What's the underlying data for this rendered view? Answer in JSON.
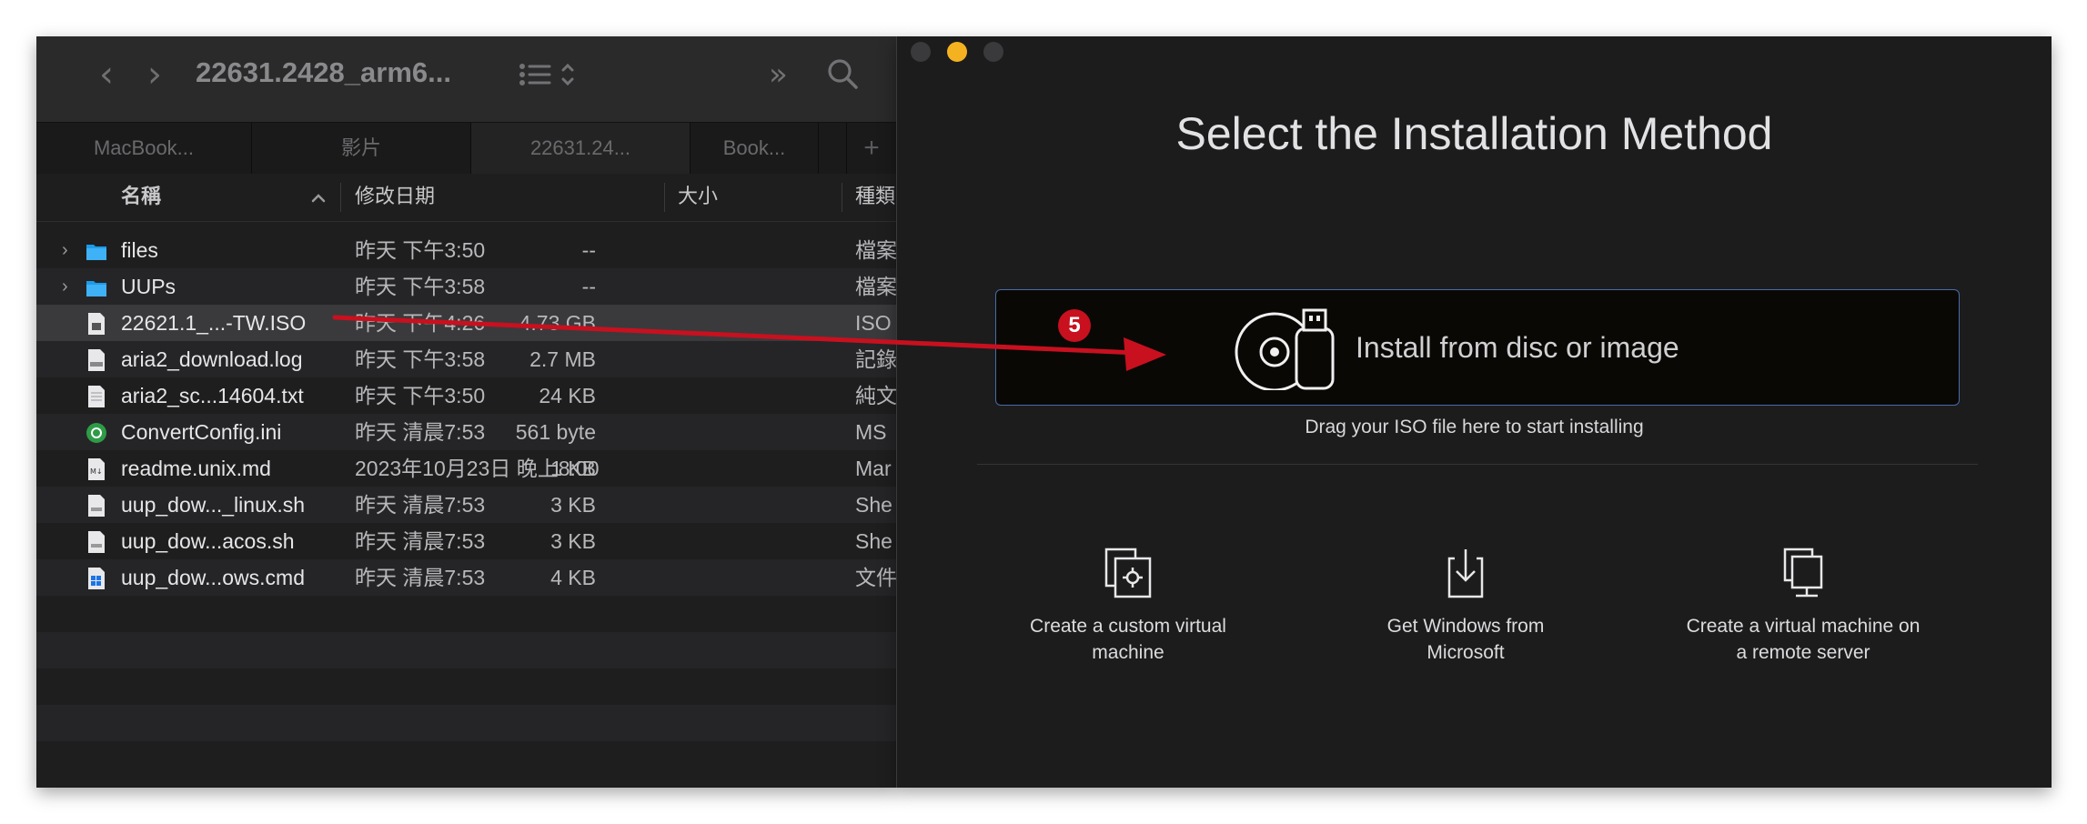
{
  "finder": {
    "title": "22631.2428_arm6...",
    "nav": {
      "back": "‹",
      "forward": "›"
    },
    "toolbar": {
      "view": "☰ ⌃",
      "more": "»",
      "search": "⌕"
    },
    "tabs": [
      {
        "label": "MacBook..."
      },
      {
        "label": "影片"
      },
      {
        "label": "22631.24..."
      },
      {
        "label": "Book..."
      },
      {
        "label": ""
      },
      {
        "label": "+"
      }
    ],
    "columns": {
      "name": "名稱",
      "sort_indicator": "^",
      "date": "修改日期",
      "size": "大小",
      "kind": "種類"
    },
    "files": [
      {
        "name": "files",
        "date": "昨天 下午3:50",
        "size": "--",
        "kind": "檔案",
        "icon": "folder-icon",
        "expandable": true
      },
      {
        "name": "UUPs",
        "date": "昨天 下午3:58",
        "size": "--",
        "kind": "檔案",
        "icon": "folder-icon",
        "expandable": true
      },
      {
        "name": "22621.1_...-TW.ISO",
        "date": "昨天 下午4:26",
        "size": "4.73 GB",
        "kind": "ISO",
        "icon": "disk-image-icon",
        "selected": true
      },
      {
        "name": "aria2_download.log",
        "date": "昨天 下午3:58",
        "size": "2.7 MB",
        "kind": "記錄",
        "icon": "log-file-icon"
      },
      {
        "name": "aria2_sc...14604.txt",
        "date": "昨天 下午3:50",
        "size": "24 KB",
        "kind": "純文",
        "icon": "text-file-icon"
      },
      {
        "name": "ConvertConfig.ini",
        "date": "昨天 清晨7:53",
        "size": "561 byte",
        "kind": "MS",
        "icon": "ini-file-icon"
      },
      {
        "name": "readme.unix.md",
        "date": "2023年10月23日 晚上8:00",
        "size": "1 KB",
        "kind": "Mar",
        "icon": "markdown-file-icon"
      },
      {
        "name": "uup_dow..._linux.sh",
        "date": "昨天 清晨7:53",
        "size": "3 KB",
        "kind": "She",
        "icon": "shell-file-icon"
      },
      {
        "name": "uup_dow...acos.sh",
        "date": "昨天 清晨7:53",
        "size": "3 KB",
        "kind": "She",
        "icon": "shell-file-icon"
      },
      {
        "name": "uup_dow...ows.cmd",
        "date": "昨天 清晨7:53",
        "size": "4 KB",
        "kind": "文件",
        "icon": "cmd-file-icon"
      }
    ]
  },
  "vm": {
    "title": "Select the Installation Method",
    "install": {
      "label": "Install from disc or image",
      "hint": "Drag your ISO file here to start installing"
    },
    "options": [
      {
        "label_line1": "Create a custom virtual",
        "label_line2": "machine",
        "icon": "custom-vm-icon"
      },
      {
        "label_line1": "Get Windows from",
        "label_line2": "Microsoft",
        "icon": "download-icon"
      },
      {
        "label_line1": "Create a virtual machine on",
        "label_line2": "a remote server",
        "icon": "remote-server-icon"
      }
    ],
    "traffic_colors": [
      "#3a3a3c",
      "#f4b221",
      "#3a3a3c"
    ]
  },
  "annotation": {
    "step": "5",
    "color": "#c8101f"
  }
}
